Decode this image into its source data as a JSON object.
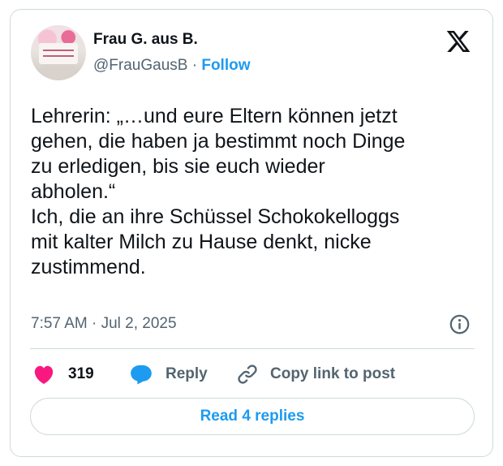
{
  "author": {
    "display_name": "Frau G. aus B.",
    "handle": "@FrauGausB",
    "separator": "·",
    "follow_label": "Follow"
  },
  "tweet": {
    "lines": [
      "Lehrerin: „…und eure Eltern können jetzt",
      "gehen, die haben ja bestimmt noch Dinge",
      "zu erledigen, bis sie euch wieder",
      "abholen.“",
      "Ich, die an ihre Schüssel Schokokelloggs",
      "mit kalter Milch zu Hause denkt, nicke",
      "zustimmend."
    ],
    "timestamp": "7:57 AM · Jul 2, 2025"
  },
  "actions": {
    "like_count": "319",
    "reply_label": "Reply",
    "copy_link_label": "Copy link to post"
  },
  "footer": {
    "read_replies_label": "Read 4 replies"
  },
  "colors": {
    "accent": "#1d9bf0",
    "like": "#f91880",
    "muted": "#536471",
    "border": "#cfd9de"
  },
  "icons": [
    "x-logo-icon",
    "info-icon",
    "heart-icon",
    "reply-bubble-icon",
    "link-icon"
  ]
}
